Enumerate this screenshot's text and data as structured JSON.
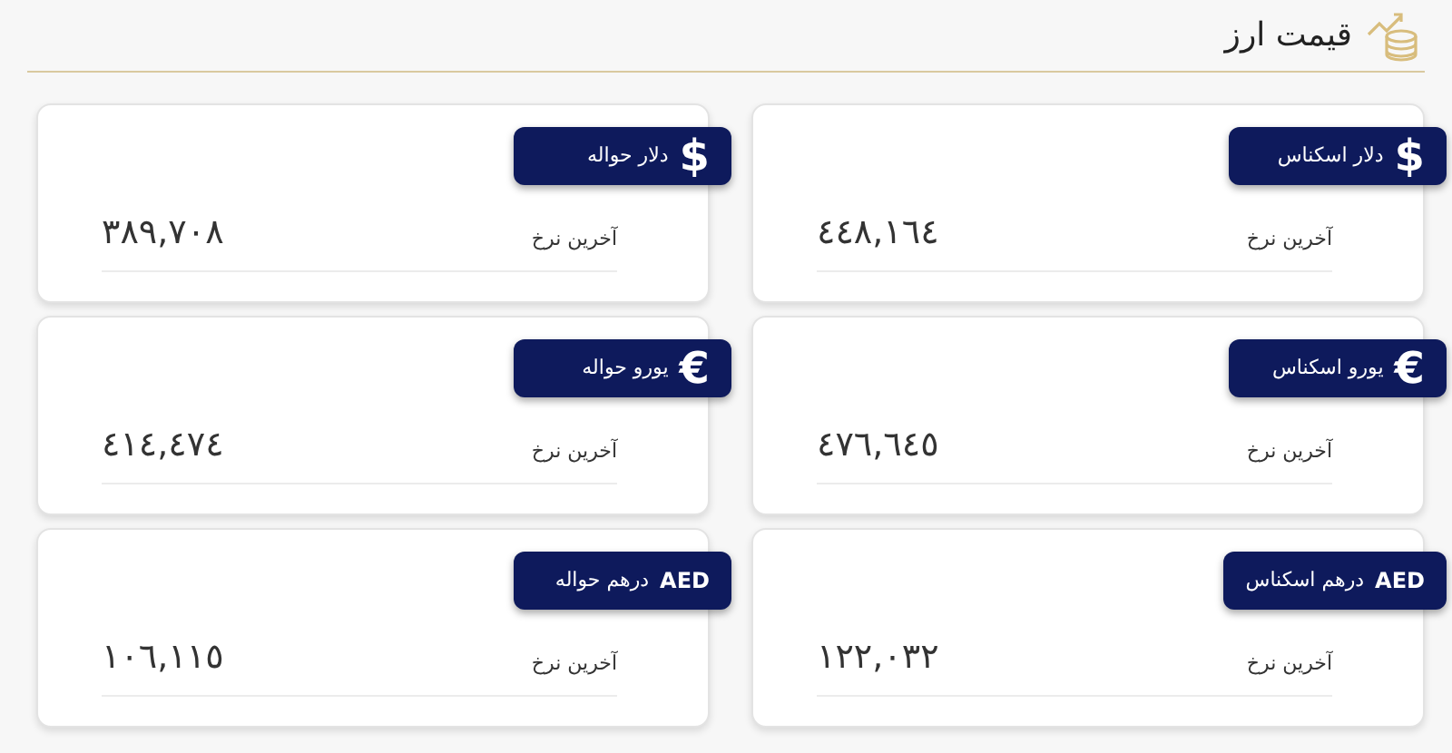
{
  "header": {
    "title": "قیمت ارز"
  },
  "cards": [
    {
      "symbol": "$",
      "name": "دلار اسکناس",
      "label": "آخرین نرخ",
      "value": "٤٤٨,١٦٤"
    },
    {
      "symbol": "$",
      "name": "دلار حواله",
      "label": "آخرین نرخ",
      "value": "٣٨٩,٧٠٨"
    },
    {
      "symbol": "€",
      "name": "یورو اسکناس",
      "label": "آخرین نرخ",
      "value": "٤٧٦,٦٤٥"
    },
    {
      "symbol": "€",
      "name": "یورو حواله",
      "label": "آخرین نرخ",
      "value": "٤١٤,٤٧٤"
    },
    {
      "symbol": "AED",
      "name": "درهم اسکناس",
      "label": "آخرین نرخ",
      "value": "١٢٢,٠٣٢"
    },
    {
      "symbol": "AED",
      "name": "درهم حواله",
      "label": "آخرین نرخ",
      "value": "١٠٦,١١٥"
    }
  ]
}
